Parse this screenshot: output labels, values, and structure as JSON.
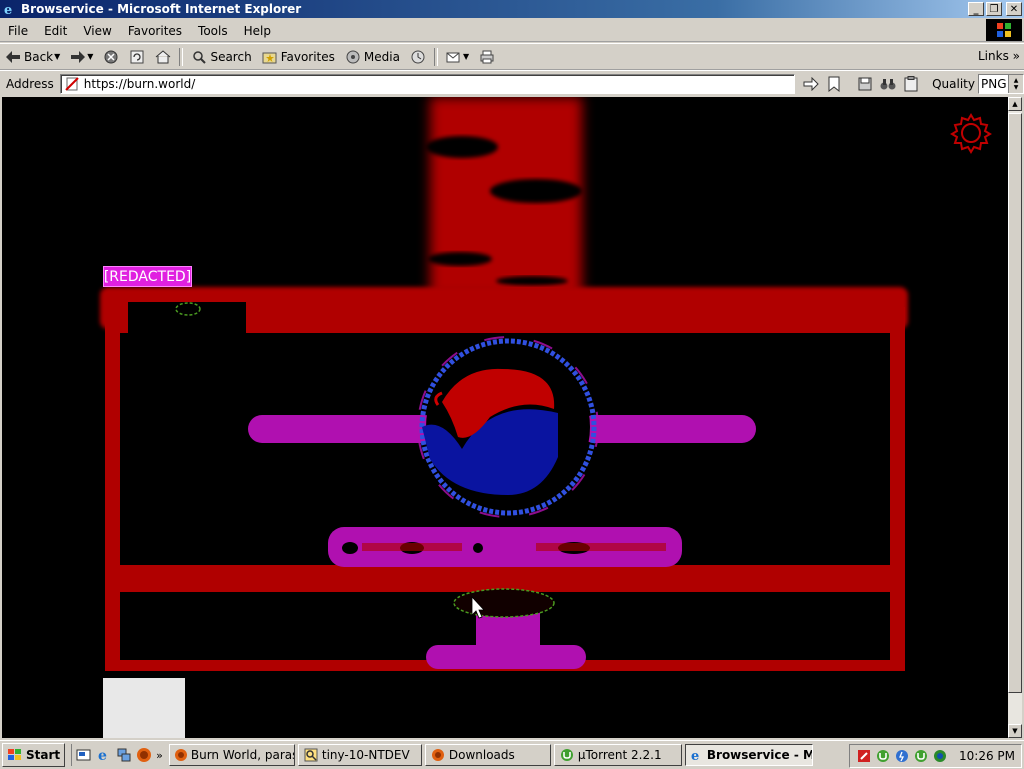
{
  "window": {
    "title": "Browservice - Microsoft Internet Explorer",
    "icons": {
      "app": "ie-icon",
      "minimize": "minimize-icon",
      "maximize": "restore-icon",
      "close": "close-icon"
    }
  },
  "menu": {
    "items": [
      "File",
      "Edit",
      "View",
      "Favorites",
      "Tools",
      "Help"
    ]
  },
  "toolbar": {
    "back_label": "Back",
    "search_label": "Search",
    "favorites_label": "Favorites",
    "media_label": "Media",
    "links_label": "Links",
    "links_chevron": "»"
  },
  "address": {
    "label": "Address",
    "url": "https://burn.world/",
    "quality_label": "Quality",
    "quality_value": "PNG"
  },
  "page": {
    "badge_text": "[REDACTED]",
    "colors": {
      "background": "#000000",
      "structure": "#b00000",
      "pipes": "#b010b0",
      "orb": "#0a14a0",
      "badge": "#e020e0"
    }
  },
  "taskbar": {
    "start_label": "Start",
    "quicklaunch_chevron": "»",
    "tasks": [
      {
        "label": "Burn World, parasit...",
        "icon": "firefox-icon",
        "active": false
      },
      {
        "label": "tiny-10-NTDEV",
        "icon": "search-icon",
        "active": false
      },
      {
        "label": "Downloads",
        "icon": "firefox-icon",
        "active": false
      },
      {
        "label": "µTorrent 2.2.1",
        "icon": "utorrent-icon",
        "active": false
      },
      {
        "label": "Browservice - Mi...",
        "icon": "ie-icon",
        "active": true
      }
    ],
    "clock": "10:26 PM"
  }
}
